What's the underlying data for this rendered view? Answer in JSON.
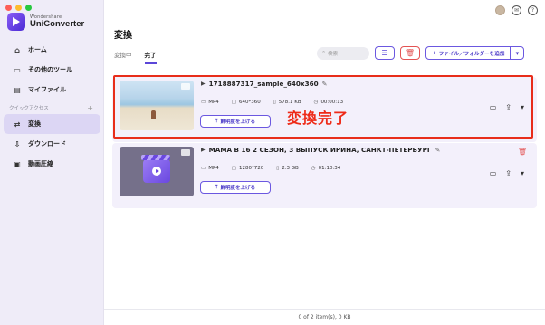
{
  "app": {
    "brand": "Wondershare",
    "name": "UniConverter"
  },
  "sidebar": {
    "items": [
      {
        "label": "ホーム",
        "icon": "home-icon"
      },
      {
        "label": "その他のツール",
        "icon": "toolbox-icon"
      },
      {
        "label": "マイファイル",
        "icon": "file-icon"
      }
    ],
    "section_label": "クイックアクセス",
    "quick_items": [
      {
        "label": "変換",
        "icon": "convert-icon",
        "active": true
      },
      {
        "label": "ダウンロード",
        "icon": "download-icon"
      },
      {
        "label": "動画圧縮",
        "icon": "compress-icon"
      }
    ]
  },
  "header": {
    "title": "変換",
    "tabs": [
      {
        "label": "変換中",
        "active": false
      },
      {
        "label": "完了",
        "active": true
      }
    ],
    "search_placeholder": "検索",
    "add_button": "ファイル／フォルダーを追加"
  },
  "files": [
    {
      "name": "1718887317_sample_640x360",
      "format": "MP4",
      "resolution": "640*360",
      "size": "578.1 KB",
      "duration": "00:00:13",
      "enhance_label": "鮮明度を上げる"
    },
    {
      "name": "МАМА В 16  2 СЕЗОН, 3 ВЫПУСК  ИРИНА, САНКТ-ПЕТЕРБУРГ",
      "format": "MP4",
      "resolution": "1280*720",
      "size": "2.3 GB",
      "duration": "01:10:34",
      "enhance_label": "鮮明度を上げる"
    }
  ],
  "annotation": "変換完了",
  "footer": "0 of 2 item(s), 0 KB",
  "colors": {
    "accent": "#5b46d8",
    "highlight": "#e82d1a",
    "delete": "#e35353"
  }
}
